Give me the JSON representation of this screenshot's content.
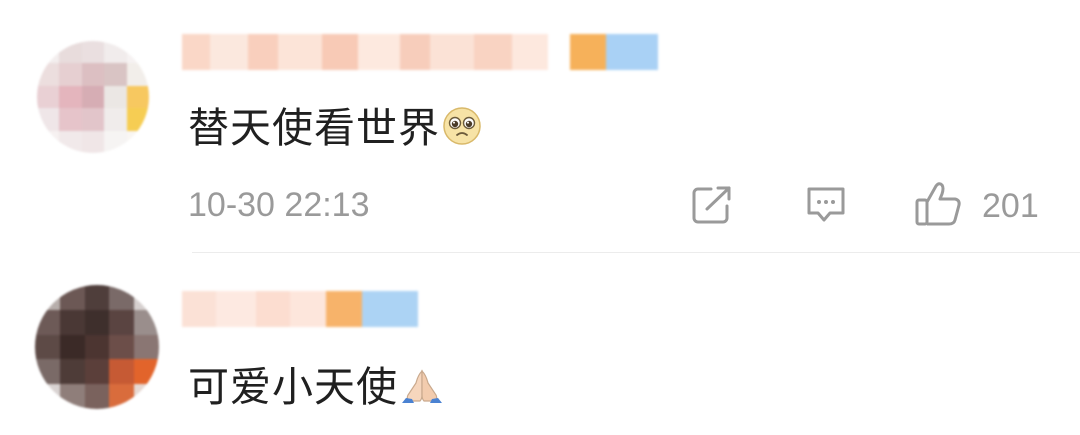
{
  "comments": [
    {
      "text": "替天使看世界",
      "emoji_icon": "pleading-face-icon",
      "timestamp": "10-30 22:13",
      "likes": "201",
      "actions": [
        "share-icon",
        "comment-icon",
        "thumbs-up-icon"
      ]
    },
    {
      "text": "可爱小天使",
      "emoji_icon": "folded-hands-icon"
    }
  ],
  "colors": {
    "text": "#202020",
    "meta": "#9a9a9a",
    "divider": "#ececec"
  }
}
